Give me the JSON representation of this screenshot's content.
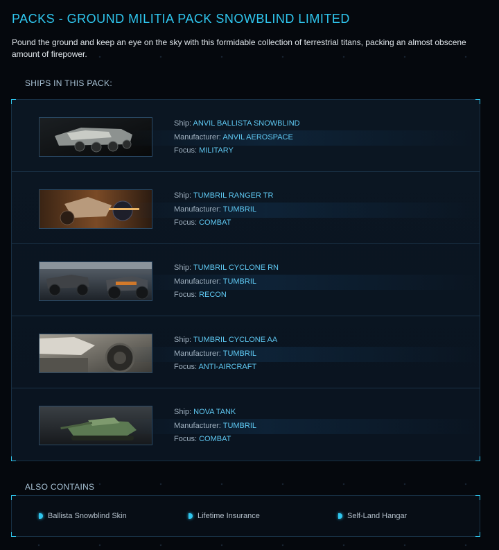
{
  "page": {
    "title": "PACKS - GROUND MILITIA PACK SNOWBLIND LIMITED",
    "description": "Pound the ground and keep an eye on the sky with this formidable collection of terrestrial titans, packing an almost obscene amount of firepower."
  },
  "ships_section": {
    "label": "SHIPS IN THIS PACK:",
    "field_labels": {
      "ship": "Ship: ",
      "manufacturer": "Manufacturer: ",
      "focus": "Focus: "
    },
    "ships": [
      {
        "name": "ANVIL BALLISTA SNOWBLIND",
        "manufacturer": "ANVIL AEROSPACE",
        "focus": "MILITARY"
      },
      {
        "name": "TUMBRIL RANGER TR",
        "manufacturer": "TUMBRIL",
        "focus": "COMBAT"
      },
      {
        "name": "TUMBRIL CYCLONE RN",
        "manufacturer": "TUMBRIL",
        "focus": "RECON"
      },
      {
        "name": "TUMBRIL CYCLONE AA",
        "manufacturer": "TUMBRIL",
        "focus": "ANTI-AIRCRAFT"
      },
      {
        "name": "NOVA TANK",
        "manufacturer": "TUMBRIL",
        "focus": "COMBAT"
      }
    ]
  },
  "also_contains": {
    "label": "ALSO CONTAINS",
    "items": [
      "Ballista Snowblind Skin",
      "Lifetime Insurance",
      "Self-Land Hangar"
    ]
  },
  "colors": {
    "accent": "#2fc6ee",
    "value_text": "#5fc9f3",
    "background": "#05080d"
  }
}
